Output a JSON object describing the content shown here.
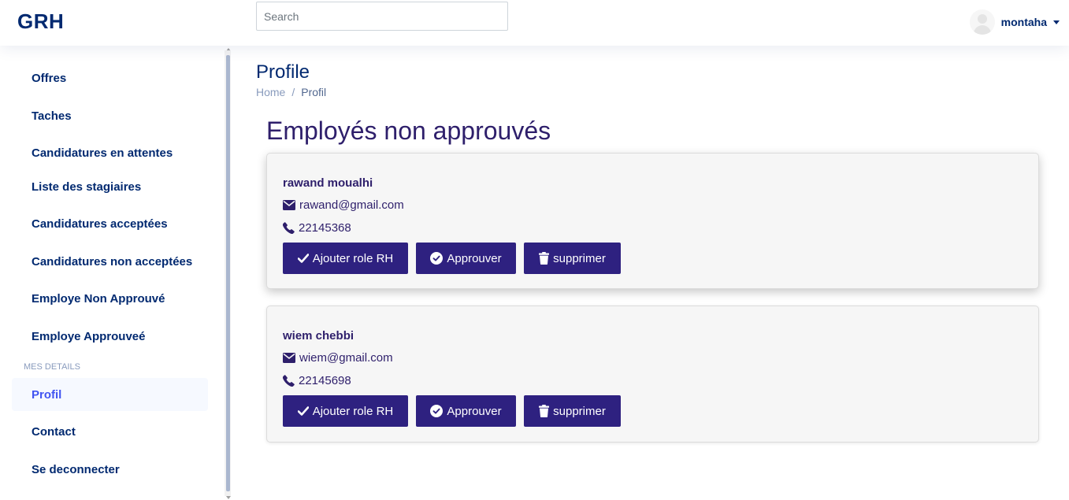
{
  "header": {
    "logo": "GRH",
    "search_placeholder": "Search",
    "username": "montaha"
  },
  "sidebar": {
    "items": [
      {
        "label": "Offres"
      },
      {
        "label": "Taches"
      },
      {
        "label": "Candidatures en attentes"
      },
      {
        "label": "Liste des stagiaires"
      },
      {
        "label": "Candidatures acceptées"
      },
      {
        "label": "Candidatures non acceptées"
      },
      {
        "label": "Employe Non Approuvé"
      },
      {
        "label": "Employe Approuveé"
      }
    ],
    "heading": "MES DETAILS",
    "details_items": [
      {
        "label": "Profil",
        "active": true
      },
      {
        "label": "Contact"
      },
      {
        "label": "Se deconnecter"
      }
    ]
  },
  "main": {
    "title": "Profile",
    "breadcrumb": {
      "home": "Home",
      "separator": "/",
      "current": "Profil"
    },
    "section_title": "Employés non approuvés",
    "buttons": {
      "add_role": "Ajouter role RH",
      "approve": "Approuver",
      "delete": "supprimer"
    },
    "employees": [
      {
        "name": "rawand moualhi",
        "email": "rawand@gmail.com",
        "phone": "22145368"
      },
      {
        "name": "wiem chebbi",
        "email": "wiem@gmail.com",
        "phone": "22145698"
      }
    ]
  },
  "icons": {
    "email": "envelope-icon",
    "phone": "phone-icon",
    "add_role": "check-icon",
    "approve": "check-circle-icon",
    "delete": "trash-icon"
  },
  "colors": {
    "brand": "#012970",
    "button": "#2e2180",
    "card_bg": "#f6f6f6",
    "active_item_bg": "#f6f9ff",
    "active_item_text": "#4154f1"
  }
}
